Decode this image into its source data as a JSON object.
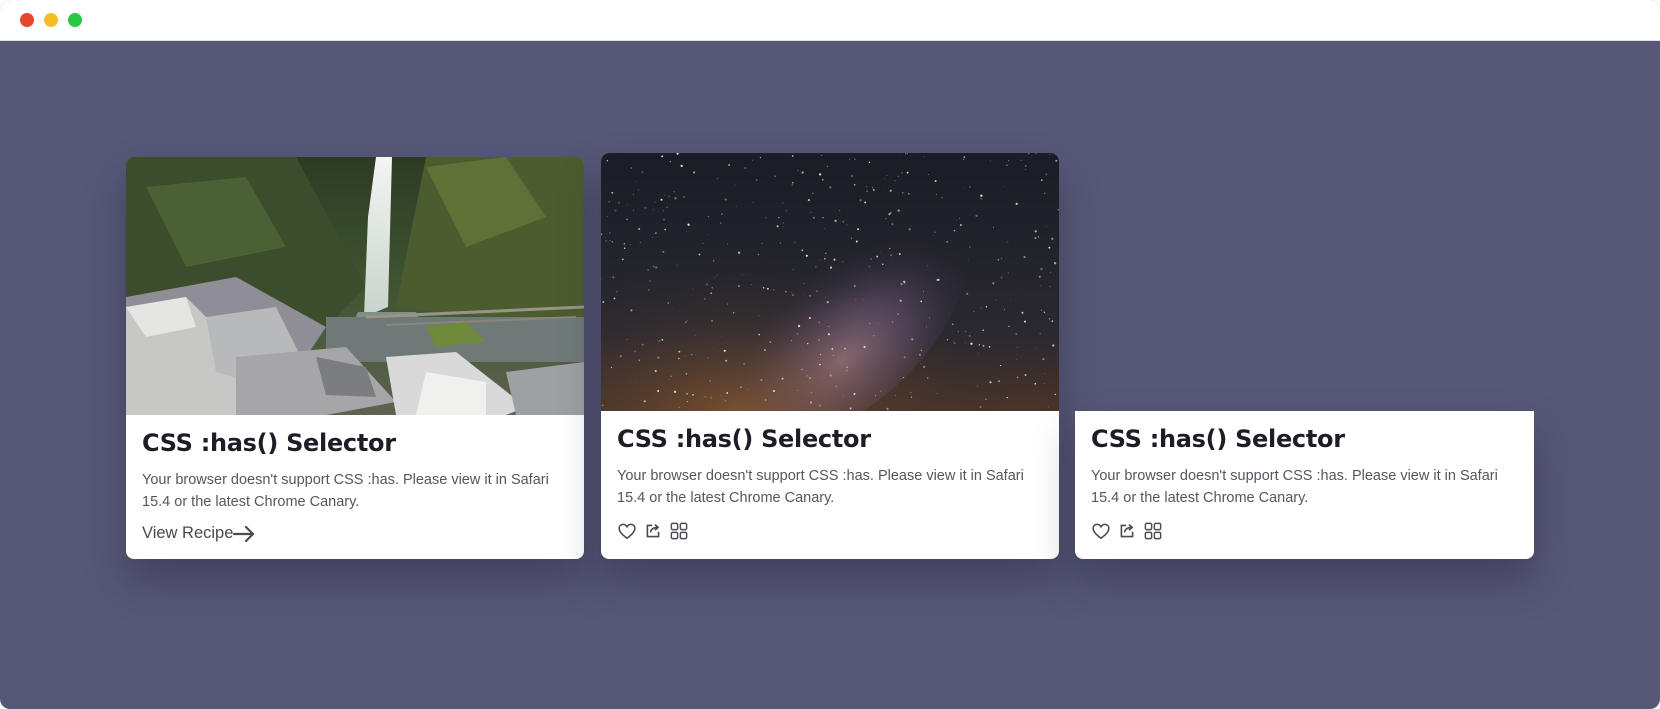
{
  "window": {
    "controls": [
      "close",
      "minimize",
      "maximize"
    ]
  },
  "cards": [
    {
      "image": "waterfall-photo",
      "title": "CSS :has() Selector",
      "description": "Your browser doesn't support CSS :has. Please view it in Safari 15.4 or the latest Chrome Canary.",
      "link_label": "View Recipe",
      "link_icon": "arrow-right-icon"
    },
    {
      "image": "milky-way-photo",
      "title": "CSS :has() Selector",
      "description": "Your browser doesn't support CSS :has. Please view it in Safari 15.4 or the latest Chrome Canary.",
      "actions": [
        "heart-icon",
        "share-icon",
        "grid-icon"
      ]
    },
    {
      "image": null,
      "title": "CSS :has() Selector",
      "description": "Your browser doesn't support CSS :has. Please view it in Safari 15.4 or the latest Chrome Canary.",
      "actions": [
        "heart-icon",
        "share-icon",
        "grid-icon"
      ]
    }
  ],
  "colors": {
    "background": "#575877",
    "card": "#ffffff",
    "title": "#1d1d26",
    "text": "#55565f"
  }
}
